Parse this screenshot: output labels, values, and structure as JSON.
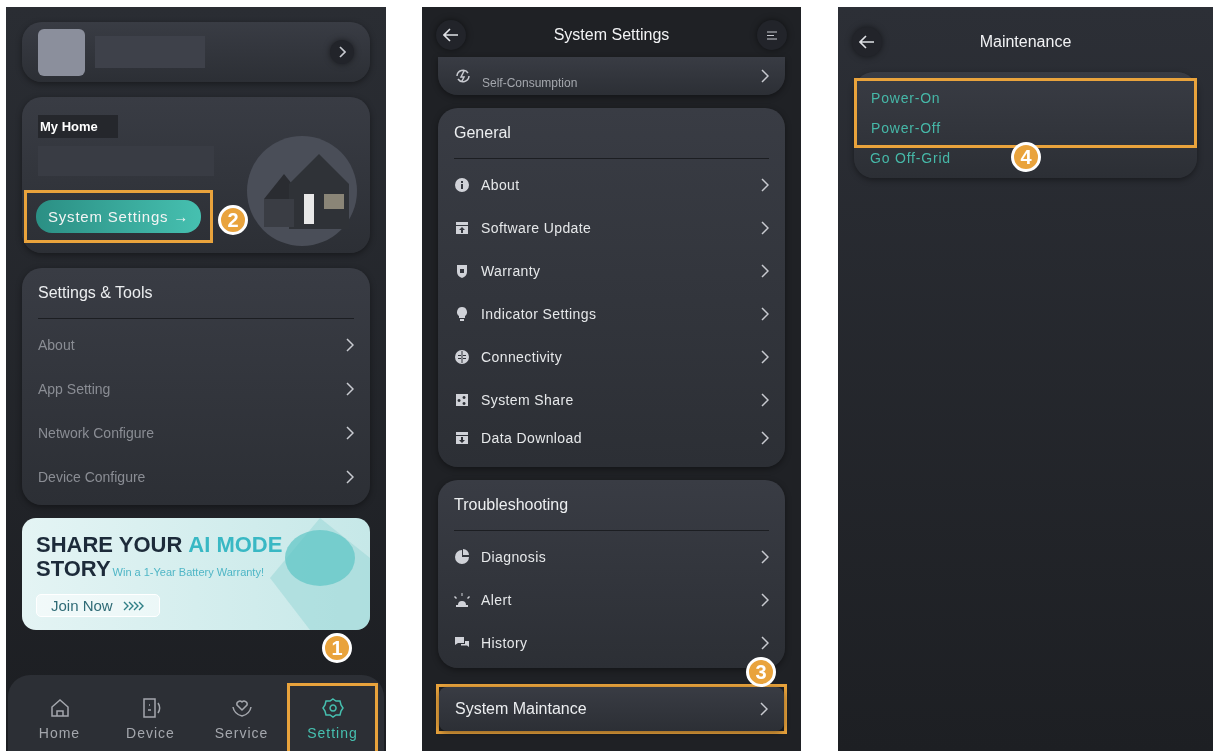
{
  "home_screen": {
    "home_card": {
      "title": "My Home",
      "button": {
        "label": "System Settings →",
        "highlighted": true
      },
      "badge": "2"
    },
    "settings_tools": {
      "title": "Settings & Tools",
      "items": [
        "About",
        "App Setting",
        "Network Configure",
        "Device Configure"
      ]
    },
    "banner": {
      "headline": [
        {
          "text": "SHARE YOUR",
          "accent": false
        },
        {
          "text": "AI MODE",
          "accent": true
        }
      ],
      "headline_line2": "STORY",
      "tagline": "Win a 1-Year Battery Warranty!",
      "button": "Join Now"
    },
    "nav_badge": "1",
    "nav": [
      {
        "label": "Home",
        "selected": false,
        "highlighted": false
      },
      {
        "label": "Device",
        "selected": false,
        "highlighted": false
      },
      {
        "label": "Service",
        "selected": false,
        "highlighted": false
      },
      {
        "label": "Setting",
        "selected": true,
        "highlighted": true
      }
    ]
  },
  "system_settings_screen": {
    "title": "System Settings",
    "mode_subtitle": "Self-Consumption",
    "sections": [
      {
        "title": "General",
        "items": [
          "About",
          "Software Update",
          "Warranty",
          "Indicator Settings",
          "Connectivity",
          "System Share",
          "Data Download"
        ]
      },
      {
        "title": "Troubleshooting",
        "items": [
          "Diagnosis",
          "Alert",
          "History"
        ]
      }
    ],
    "maintenance": {
      "label": "System Maintance",
      "highlighted": true
    },
    "badge": "3"
  },
  "maintenance_screen": {
    "title": "Maintenance",
    "items": [
      {
        "label": "Power-On",
        "highlighted": true
      },
      {
        "label": "Power-Off",
        "highlighted": true
      },
      {
        "label": "Go Off-Grid",
        "highlighted": false
      }
    ],
    "badge": "4"
  }
}
